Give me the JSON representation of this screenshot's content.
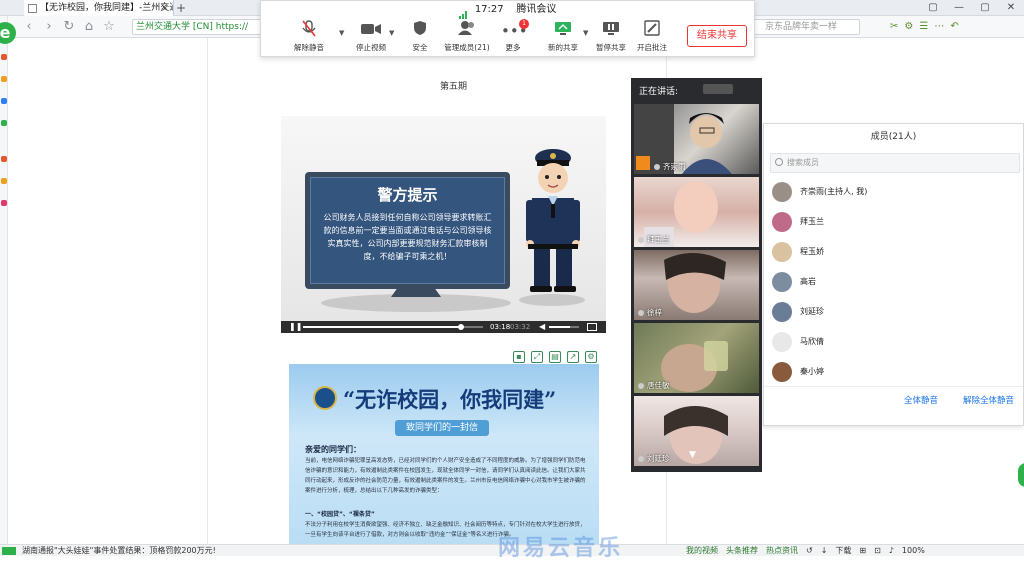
{
  "browser": {
    "tab_title": "【无诈校园，你我同建】-兰州交通",
    "tab_close": "×",
    "new_tab": "+",
    "site_badge": "兰州交通大学 [CN]",
    "url_prefix": "https://",
    "jd_search_placeholder": "京东品牌年卖一样",
    "toolbar_right": [
      "✂",
      "⚙",
      "☰",
      "⋯",
      "↶"
    ],
    "window_controls": [
      "▢",
      "—",
      "▢",
      "✕"
    ]
  },
  "meeting": {
    "time": "17:27",
    "app_name": "腾讯会议",
    "buttons": [
      {
        "icon": "mic-off-icon",
        "label": "解除静音"
      },
      {
        "icon": "camera-icon",
        "label": "停止视频"
      },
      {
        "icon": "shield-icon",
        "label": "安全"
      },
      {
        "icon": "members-icon",
        "label": "管理成员(21)"
      },
      {
        "icon": "more-icon",
        "label": "更多"
      },
      {
        "icon": "share-icon",
        "label": "新的共享"
      },
      {
        "icon": "pause-icon",
        "label": "暂停共享"
      },
      {
        "icon": "annotate-icon",
        "label": "开启批注"
      }
    ],
    "more_badge": "1",
    "end_share": "结束共享"
  },
  "document": {
    "issue_title": "第五期",
    "video": {
      "tv_title": "警方提示",
      "tv_text": "公司财务人员接到任何自称公司领导要求转账汇款的信息前一定要当面或通过电话与公司领导核实真实性，公司内部更要规范财务汇款审核制度，不给骗子可乘之机！",
      "time_current": "03:18",
      "time_total": "03:32",
      "progress": 0.88,
      "volume": 0.7
    },
    "poster": {
      "title": "“无诈校园，你我同建”",
      "ribbon": "致同学们的一封信",
      "greeting": "亲爱的同学们：",
      "body": "当前，电信网络诈骗犯罪呈高发态势，已经对同学们的个人财产安全造成了不同程度的威胁。为了增强同学们防范电信诈骗的意识和能力，有效遏制此类案件在校园发生，现就全体同学一封信，请同学们认真阅读此信。让我们大家共同行动起来，形成反诈的社会防范力量，有效遏制此类案件的发生。兰州市反电信网络诈骗中心对我市学生被诈骗的案件进行分析，梳理，总结出以下几种高发的诈骗类型：",
      "item": "一、“校园贷”、“裸条贷”",
      "body2": "不法分子利用在校学生消费欲望强、经济不独立、缺乏金融知识、社会阅历等特点，专门针对在校大学生进行放贷，一旦有学生向该平台进行了借款，对方则会以收取“违约金”“保证金”等名义进行诈骗。"
    }
  },
  "video_panel": {
    "label": "正在讲话:",
    "tiles": [
      {
        "name": "齐崇雨"
      },
      {
        "name": "拜玉兰"
      },
      {
        "name": "徐梓"
      },
      {
        "name": "唐佳敏"
      },
      {
        "name": "刘延珍"
      }
    ],
    "down_arrow": "▼"
  },
  "members": {
    "title": "成员(21人)",
    "search_placeholder": "搜索成员",
    "list": [
      {
        "name": "齐崇雨(主持人, 我)",
        "color": "#9a8f86"
      },
      {
        "name": "拜玉兰",
        "color": "#c06a8a"
      },
      {
        "name": "程玉娇",
        "color": "#d8c2a0"
      },
      {
        "name": "高岩",
        "color": "#7d8da0"
      },
      {
        "name": "刘延珍",
        "color": "#6a7c96"
      },
      {
        "name": "马欣倩",
        "color": "#e8e8e8"
      },
      {
        "name": "秦小婷",
        "color": "#8a5a3c"
      }
    ],
    "mute_all": "全体静音",
    "unmute_all": "解除全体静音"
  },
  "statusbar": {
    "news": "湖南通报\"大头娃娃\"事件处置结果：顶格罚款200万元!",
    "right_items": [
      "我的视频",
      "头条推荐",
      "热点资讯",
      "↺",
      "↓",
      "下载",
      "⊞",
      "⊡",
      "♪",
      "100%"
    ]
  },
  "watermark": "网易云音乐"
}
